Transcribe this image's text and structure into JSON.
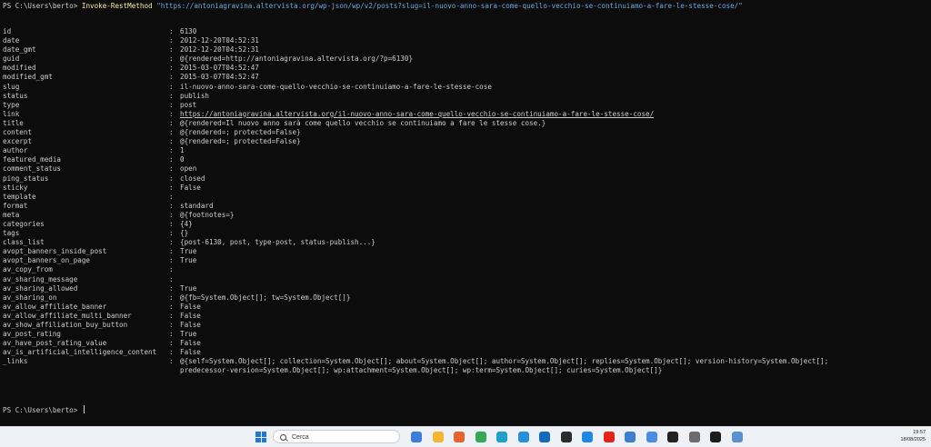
{
  "terminal": {
    "prompt": "PS C:\\Users\\berto> ",
    "command": "Invoke-RestMethod",
    "argument": "\"https://antoniagravina.altervista.org/wp-json/wp/v2/posts?slug=il-nuovo-anno-sara-come-quello-vecchio-se-continuiamo-a-fare-le-stesse-cose/\"",
    "separator": ":",
    "properties": [
      {
        "key": "id",
        "value": "6130"
      },
      {
        "key": "date",
        "value": "2012-12-20T04:52:31"
      },
      {
        "key": "date_gmt",
        "value": "2012-12-20T04:52:31"
      },
      {
        "key": "guid",
        "value": "@{rendered=http://antoniagravina.altervista.org/?p=6130}"
      },
      {
        "key": "modified",
        "value": "2015-03-07T04:52:47"
      },
      {
        "key": "modified_gmt",
        "value": "2015-03-07T04:52:47"
      },
      {
        "key": "slug",
        "value": "il-nuovo-anno-sara-come-quello-vecchio-se-continuiamo-a-fare-le-stesse-cose"
      },
      {
        "key": "status",
        "value": "publish"
      },
      {
        "key": "type",
        "value": "post"
      },
      {
        "key": "link",
        "value": "https://antoniagravina.altervista.org/il-nuovo-anno-sara-come-quello-vecchio-se-continuiamo-a-fare-le-stesse-cose/",
        "is_link": true
      },
      {
        "key": "title",
        "value": "@{rendered=Il nuovo anno sarà come quello vecchio se continuiamo a fare le stesse cose.}"
      },
      {
        "key": "content",
        "value": "@{rendered=; protected=False}"
      },
      {
        "key": "excerpt",
        "value": "@{rendered=; protected=False}"
      },
      {
        "key": "author",
        "value": "1"
      },
      {
        "key": "featured_media",
        "value": "0"
      },
      {
        "key": "comment_status",
        "value": "open"
      },
      {
        "key": "ping_status",
        "value": "closed"
      },
      {
        "key": "sticky",
        "value": "False"
      },
      {
        "key": "template",
        "value": ""
      },
      {
        "key": "format",
        "value": "standard"
      },
      {
        "key": "meta",
        "value": "@{footnotes=}"
      },
      {
        "key": "categories",
        "value": "{4}"
      },
      {
        "key": "tags",
        "value": "{}"
      },
      {
        "key": "class_list",
        "value": "{post-6130, post, type-post, status-publish...}"
      },
      {
        "key": "avopt_banners_inside_post",
        "value": "True"
      },
      {
        "key": "avopt_banners_on_page",
        "value": "True"
      },
      {
        "key": "av_copy_from",
        "value": ""
      },
      {
        "key": "av_sharing_message",
        "value": ""
      },
      {
        "key": "av_sharing_allowed",
        "value": "True"
      },
      {
        "key": "av_sharing_on",
        "value": "@{fb=System.Object[]; tw=System.Object[]}"
      },
      {
        "key": "av_allow_affiliate_banner",
        "value": "False"
      },
      {
        "key": "av_allow_affiliate_multi_banner",
        "value": "False"
      },
      {
        "key": "av_show_affiliation_buy_button",
        "value": "False"
      },
      {
        "key": "av_post_rating",
        "value": "True"
      },
      {
        "key": "av_have_post_rating_value",
        "value": "False"
      },
      {
        "key": "av_is_artificial_intelligence_content",
        "value": "False"
      },
      {
        "key": "_links",
        "value": "@{self=System.Object[]; collection=System.Object[]; about=System.Object[]; author=System.Object[]; replies=System.Object[]; version-history=System.Object[];\npredecessor-version=System.Object[]; wp:attachment=System.Object[]; wp:term=System.Object[]; curies=System.Object[]}"
      }
    ],
    "final_prompt": "PS C:\\Users\\berto> "
  },
  "taskbar": {
    "search_placeholder": "Cerca",
    "time": "19:57",
    "date": "18/08/2025",
    "icons": [
      {
        "name": "widgets-icon",
        "color": "#3b7dd8"
      },
      {
        "name": "file-explorer-icon",
        "color": "#f2b632"
      },
      {
        "name": "firefox-icon",
        "color": "#e8622c"
      },
      {
        "name": "chrome-icon",
        "color": "#34a853"
      },
      {
        "name": "edge-icon",
        "color": "#1fa0c8"
      },
      {
        "name": "photos-icon",
        "color": "#2a8fd6"
      },
      {
        "name": "outlook-icon",
        "color": "#0f6cbd"
      },
      {
        "name": "sticky-app-icon",
        "color": "#2b2b2b"
      },
      {
        "name": "files-icon",
        "color": "#1e88e5"
      },
      {
        "name": "youtube-icon",
        "color": "#e62117"
      },
      {
        "name": "pen-app-icon",
        "color": "#3f7fd0"
      },
      {
        "name": "todo-icon",
        "color": "#4a8de8"
      },
      {
        "name": "shield-app-icon",
        "color": "#222222"
      },
      {
        "name": "settings-icon",
        "color": "#6b6b6b"
      },
      {
        "name": "terminal-icon",
        "color": "#1b1b1b"
      },
      {
        "name": "notepad-icon",
        "color": "#5a8fd0"
      }
    ]
  }
}
